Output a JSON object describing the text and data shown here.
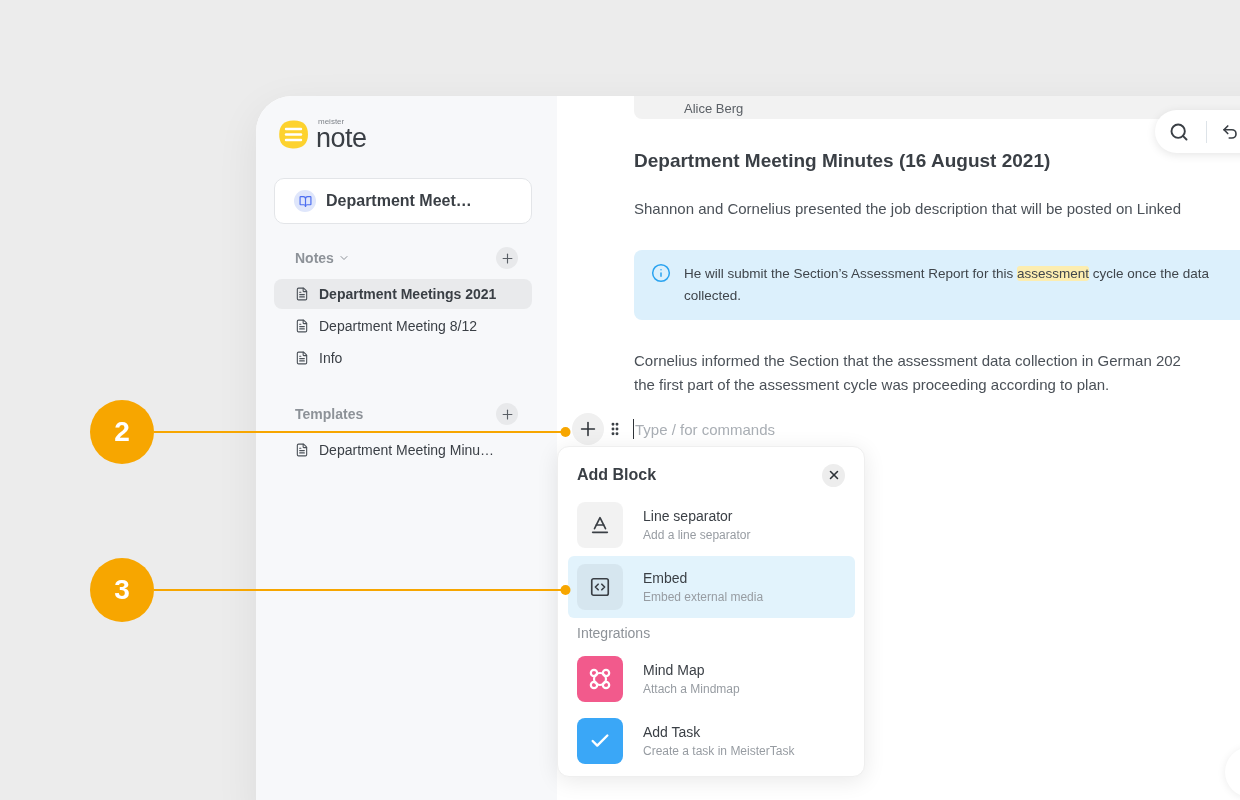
{
  "sidebar": {
    "logo": {
      "tagline": "meister",
      "wordmark": "note"
    },
    "notebook": {
      "title": "Department Meet…"
    },
    "sections": [
      {
        "title": "Notes",
        "dropdown": true,
        "items": [
          {
            "label": "Department Meetings 2021",
            "selected": true
          },
          {
            "label": "Department Meeting 8/12",
            "selected": false
          },
          {
            "label": "Info",
            "selected": false
          }
        ]
      },
      {
        "title": "Templates",
        "dropdown": false,
        "items": [
          {
            "label": "Department Meeting Minu…",
            "selected": false
          }
        ]
      }
    ]
  },
  "document": {
    "author_card": {
      "name": "Alice Berg"
    },
    "blocks": [
      {
        "kind": "heading",
        "lines": [
          "Department Meeting Minutes (16 August 2021)"
        ]
      },
      {
        "kind": "paragraph",
        "lines": [
          "Shannon and Cornelius presented the job description that will be posted on Linked"
        ]
      },
      {
        "kind": "callout",
        "lines": [
          {
            "segments": [
              {
                "text": "He will submit the Section’s Assessment Report for this ",
                "highlighted": false
              },
              {
                "text": "assessment",
                "highlighted": true
              },
              {
                "text": " cycle once the data",
                "highlighted": false
              }
            ]
          },
          {
            "segments": [
              {
                "text": "collected.",
                "highlighted": false
              }
            ]
          }
        ]
      },
      {
        "kind": "paragraph",
        "lines": [
          "Cornelius informed the Section that the assessment data collection in German 202",
          "the first part of the assessment cycle was proceeding according to plan."
        ]
      }
    ]
  },
  "editor": {
    "placeholder": "Type / for commands"
  },
  "add_block_menu": {
    "title": "Add Block",
    "groups": [
      {
        "items": [
          {
            "kind": "separator",
            "title": "Line separator",
            "subtitle": "Add a line separator",
            "selected": false
          },
          {
            "kind": "embed",
            "title": "Embed",
            "subtitle": "Embed external media",
            "selected": true
          }
        ]
      },
      {
        "label": "Integrations",
        "items": [
          {
            "kind": "mindmap",
            "title": "Mind Map",
            "subtitle": "Attach a Mindmap",
            "selected": false
          },
          {
            "kind": "task",
            "title": "Add Task",
            "subtitle": "Create a task in MeisterTask",
            "selected": false
          }
        ]
      }
    ]
  },
  "callouts": [
    {
      "number": "2"
    },
    {
      "number": "3"
    }
  ]
}
